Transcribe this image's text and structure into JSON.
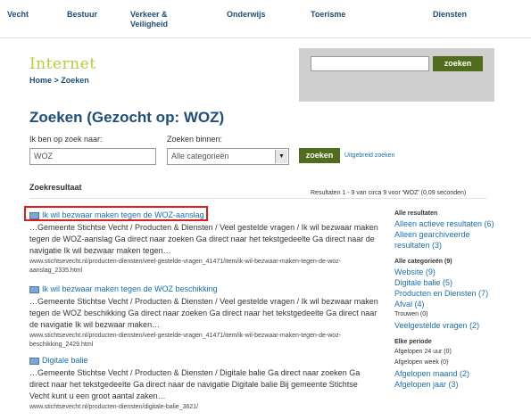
{
  "topnav": {
    "items": [
      "Vecht",
      "Bestuur",
      "Verkeer &\nVeiligheid",
      "Onderwijs",
      "Toerisme",
      "Diensten"
    ]
  },
  "brand": {
    "logo_text": "Internet"
  },
  "breadcrumb": {
    "text": "Home > Zoeken"
  },
  "header_search": {
    "value": "",
    "button_label": "zoeken"
  },
  "page": {
    "title": "Zoeken (Gezocht op: WOZ)"
  },
  "search_form": {
    "query_label": "Ik ben op zoek naar:",
    "query_value": "WOZ",
    "scope_label": "Zoeken binnen:",
    "scope_value": "Alle categorieën",
    "submit_label": "zoeken",
    "advanced_link": "Uitgebreid zoeken"
  },
  "results": {
    "heading": "Zoekresultaat",
    "count_text": "Resultaten 1 - 9 van circa 9 voor 'WOZ' (0,09 seconden)",
    "items": [
      {
        "title": "Ik wil bezwaar maken tegen de WOZ-aanslag",
        "snippet": "…Gemeente Stichtse Vecht / Producten & Diensten / Veel gestelde vragen / Ik wil bezwaar maken tegen de WOZ-aanslag Ga direct naar zoeken Ga direct naar het tekstgedeelte Ga direct naar de navigatie Ik wil bezwaar maken tegen…",
        "url": "www.stichtsevecht.nl/producten-diensten/veel-gestelde-vragen_41471/item/ik-wil-bezwaar-maken-tegen-de-woz-aanslag_2335.html"
      },
      {
        "title": "Ik wil bezwaar maken tegen de WOZ beschikking",
        "snippet": "…Gemeente Stichtse Vecht / Producten & Diensten / Veel gestelde vragen / Ik wil bezwaar maken tegen de WOZ beschikking Ga direct naar zoeken Ga direct naar het tekstgedeelte Ga direct naar de navigatie Ik wil bezwaar maken…",
        "url": "www.stichtsevecht.nl/producten-diensten/veel-gestelde-vragen_41471/item/ik-wil-bezwaar-maken-tegen-de-woz-beschikking_2429.html"
      },
      {
        "title": "Digitale balie",
        "snippet": "…Gemeente Stichtse Vecht / Producten & Diensten / Digitale balie Ga direct naar zoeken Ga direct naar het tekstgedeelte Ga direct naar de navigatie Digitale balie Bij gemeente Stichtse Vecht kunt u een groot aantal zaken…",
        "url": "www.stichtsevecht.nl/producten-diensten/digitale-balie_3621/"
      }
    ]
  },
  "sidebar": {
    "all_results": {
      "heading": "Alle resultaten",
      "links": [
        "Alleen actieve resultaten (6)",
        "Alleen gearchiveerde resultaten (3)"
      ]
    },
    "categories": {
      "heading": "Alle categorieën (9)",
      "links": [
        "Website (9)",
        "Digitale balie (5)",
        "Producten en Diensten (7)",
        "Afval (4)"
      ],
      "plain": "Trouwen (0)",
      "links2": [
        "Veelgestelde vragen (2)"
      ]
    },
    "period": {
      "heading": "Elke periode",
      "entries": [
        {
          "label": "Afgelopen 24 uur (0)",
          "link": false
        },
        {
          "label": "Afgelopen week (0)",
          "link": false
        },
        {
          "label": "Afgelopen maand (2)",
          "link": true
        },
        {
          "label": "Afgelopen jaar (3)",
          "link": true
        }
      ]
    }
  },
  "colors": {
    "nav_blue": "#1f4e7a",
    "link_blue": "#1a6fb3",
    "brand_green": "#b6cc3a",
    "button_green": "#4f6d1c",
    "highlight_red": "#e01d1d"
  }
}
